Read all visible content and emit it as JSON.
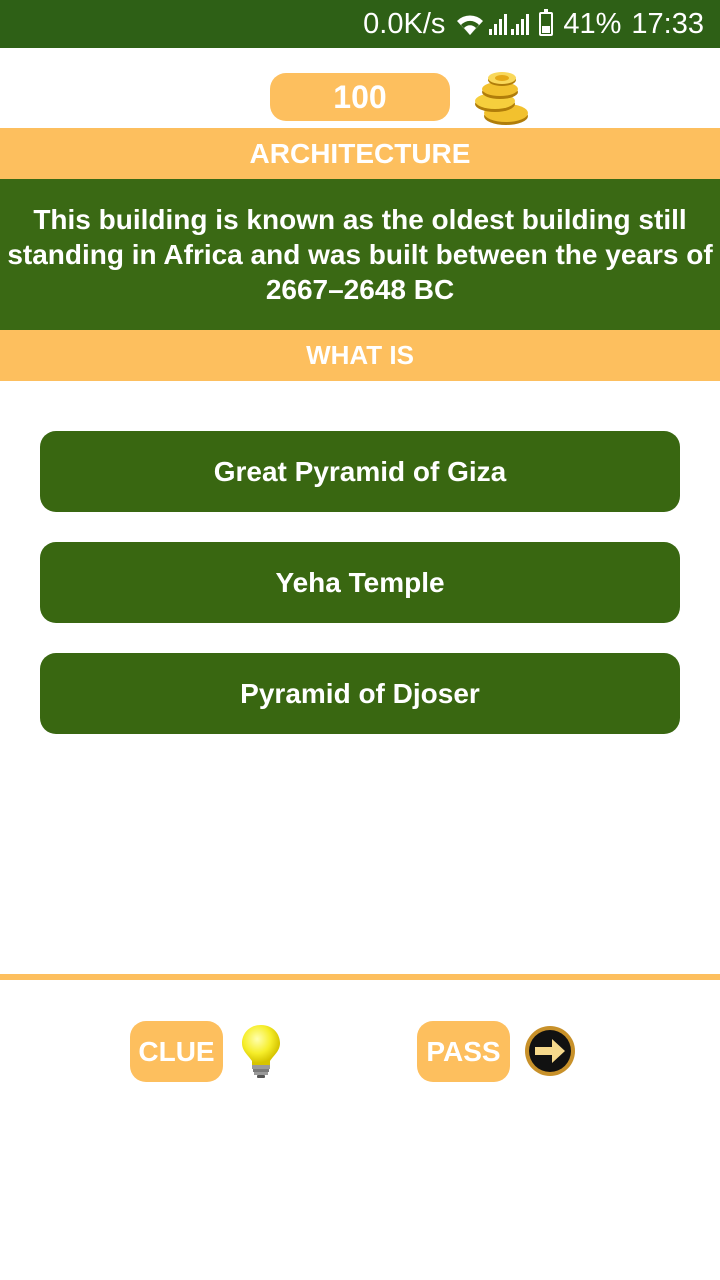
{
  "status_bar": {
    "net_speed": "0.0K/s",
    "battery_level": "41%",
    "battery_fraction": 0.41,
    "time": "17:33",
    "icons": [
      "wifi-icon",
      "signal-icon",
      "signal-icon",
      "battery-icon"
    ]
  },
  "coins": {
    "value": "100",
    "icon": "gold-coins-icon"
  },
  "category": "ARCHITECTURE",
  "question": "This building is known as the oldest building still standing in Africa and was built between the years of 2667–2648 BC",
  "prompt": "WHAT IS",
  "answers": [
    {
      "label": "Great Pyramid of Giza"
    },
    {
      "label": "Yeha Temple"
    },
    {
      "label": "Pyramid of Djoser"
    }
  ],
  "footer": {
    "clue_label": "CLUE",
    "clue_icon": "lightbulb-icon",
    "pass_label": "PASS",
    "pass_icon": "arrow-right-icon"
  },
  "colors": {
    "dark_green": "#3a6914",
    "status_green": "#2e6016",
    "accent_orange": "#fdbf5e",
    "white": "#ffffff"
  }
}
